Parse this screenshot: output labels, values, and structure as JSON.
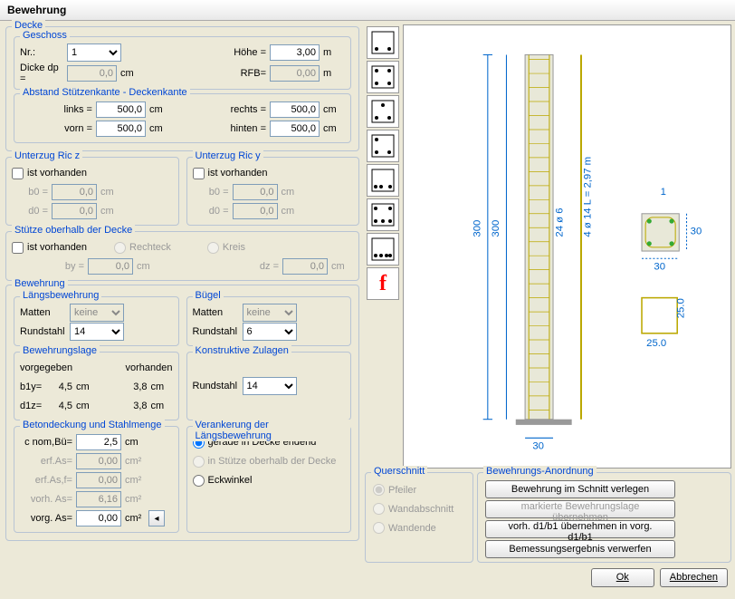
{
  "title": "Bewehrung",
  "decke": {
    "title": "Decke",
    "geschoss": {
      "title": "Geschoss",
      "nr_label": "Nr.:",
      "nr_value": "1",
      "hoehe_label": "Höhe =",
      "hoehe_value": "3,00",
      "hoehe_unit": "m",
      "dicke_label": "Dicke dp =",
      "dicke_value": "0,0",
      "dicke_unit": "cm",
      "rfb_label": "RFB=",
      "rfb_value": "0,00",
      "rfb_unit": "m"
    },
    "abstand": {
      "title": "Abstand Stützenkante - Deckenkante",
      "links_label": "links =",
      "links_value": "500,0",
      "rechts_label": "rechts =",
      "rechts_value": "500,0",
      "vorn_label": "vorn =",
      "vorn_value": "500,0",
      "hinten_label": "hinten =",
      "hinten_value": "500,0",
      "unit": "cm"
    }
  },
  "unterzug_z": {
    "title": "Unterzug Ric z",
    "vorhanden": "ist vorhanden",
    "b0": "b0 =",
    "b0_v": "0,0",
    "d0": "d0 =",
    "d0_v": "0,0",
    "unit": "cm"
  },
  "unterzug_y": {
    "title": "Unterzug Ric y",
    "vorhanden": "ist vorhanden",
    "b0": "b0 =",
    "b0_v": "0,0",
    "d0": "d0 =",
    "d0_v": "0,0",
    "unit": "cm"
  },
  "stuetze": {
    "title": "Stütze oberhalb der Decke",
    "vorhanden": "ist vorhanden",
    "rechteck": "Rechteck",
    "kreis": "Kreis",
    "by": "by =",
    "by_v": "0,0",
    "dz": "dz =",
    "dz_v": "0,0",
    "unit": "cm"
  },
  "bewehrung": {
    "title": "Bewehrung",
    "laengs": {
      "title": "Längsbewehrung",
      "matten": "Matten",
      "matten_v": "keine",
      "rund": "Rundstahl",
      "rund_v": "14"
    },
    "buegel": {
      "title": "Bügel",
      "matten": "Matten",
      "matten_v": "keine",
      "rund": "Rundstahl",
      "rund_v": "6"
    },
    "lage": {
      "title": "Bewehrungslage",
      "vorgegeben": "vorgegeben",
      "vorhanden": "vorhanden",
      "b1y": "b1y=",
      "b1y_v": "4,5",
      "b1y_vh": "3,8",
      "d1z": "d1z=",
      "d1z_v": "4,5",
      "d1z_vh": "3,8",
      "unit": "cm"
    },
    "konstr": {
      "title": "Konstruktive Zulagen",
      "rund": "Rundstahl",
      "rund_v": "14"
    },
    "beton": {
      "title": "Betondeckung und Stahlmenge",
      "cnom": "c nom,Bü=",
      "cnom_v": "2,5",
      "cnom_u": "cm",
      "erfas": "erf.As=",
      "erfas_v": "0,00",
      "erfas_u": "cm²",
      "erfasf": "erf.As,f=",
      "erfasf_v": "0,00",
      "erfasf_u": "cm²",
      "vorh": "vorh. As=",
      "vorh_v": "6,16",
      "vorh_u": "cm²",
      "vorg": "vorg. As=",
      "vorg_v": "0,00",
      "vorg_u": "cm²"
    },
    "verank": {
      "title": "Verankerung der Längsbewehrung",
      "opt1": "gerade in Decke endend",
      "opt2": "in Stütze oberhalb der Decke",
      "opt3": "Eckwinkel"
    }
  },
  "querschnitt": {
    "title": "Querschnitt",
    "pfeiler": "Pfeiler",
    "wandab": "Wandabschnitt",
    "wandende": "Wandende"
  },
  "anordnung": {
    "title": "Bewehrungs-Anordnung",
    "b1": "Bewehrung im Schnitt verlegen",
    "b2": "markierte Bewehrungslage übernehmen",
    "b3": "vorh. d1/b1 übernehmen in vorg. d1/b1",
    "b4": "Bemessungsergebnis verwerfen"
  },
  "ok": "Ok",
  "abbrechen": "Abbrechen",
  "diagram": {
    "num": "1",
    "h": "300",
    "h2": "300",
    "stir": "24 ø 6",
    "l": "4 ø 14  L = 2,97 m",
    "w": "30",
    "w2": "30",
    "w3": "25.0",
    "h3": "25.0"
  }
}
